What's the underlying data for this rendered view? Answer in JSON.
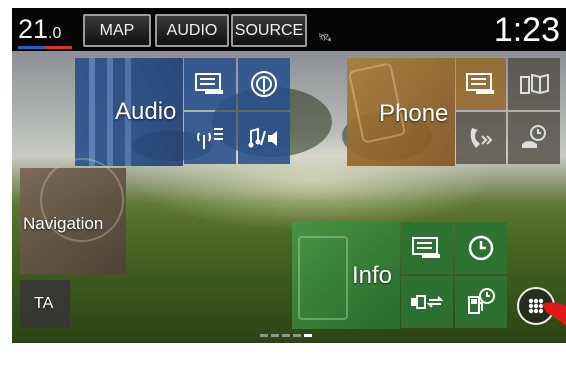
{
  "status_bar": {
    "temperature_main": "21",
    "temperature_decimal": ".0",
    "clock": "1:23",
    "buttons": [
      "MAP",
      "AUDIO",
      "SOURCE"
    ],
    "gps_icon": "satellite-icon"
  },
  "tiles": {
    "audio": {
      "label": "Audio",
      "color": "#2f5c96"
    },
    "phone": {
      "label": "Phone",
      "color": "#9a6a2a"
    },
    "navigation": {
      "label": "Navigation",
      "color": "#6d5a4e"
    },
    "info": {
      "label": "Info",
      "color": "#2f7a32"
    },
    "ta": {
      "label": "TA"
    }
  },
  "icons": {
    "audio_shortcuts": [
      "text-display-icon",
      "radio-icon",
      "antenna-list-icon",
      "music-speaker-icon"
    ],
    "phone_shortcuts": [
      "text-display-icon",
      "phonebook-icon",
      "speed-dial-icon",
      "call-history-icon"
    ],
    "info_shortcuts": [
      "text-display-icon",
      "clock-icon",
      "trip-computer-icon",
      "fuel-clock-icon"
    ],
    "home_menu": "menu-grid-icon"
  },
  "page_indicator": {
    "pages": 5,
    "current": 5
  }
}
